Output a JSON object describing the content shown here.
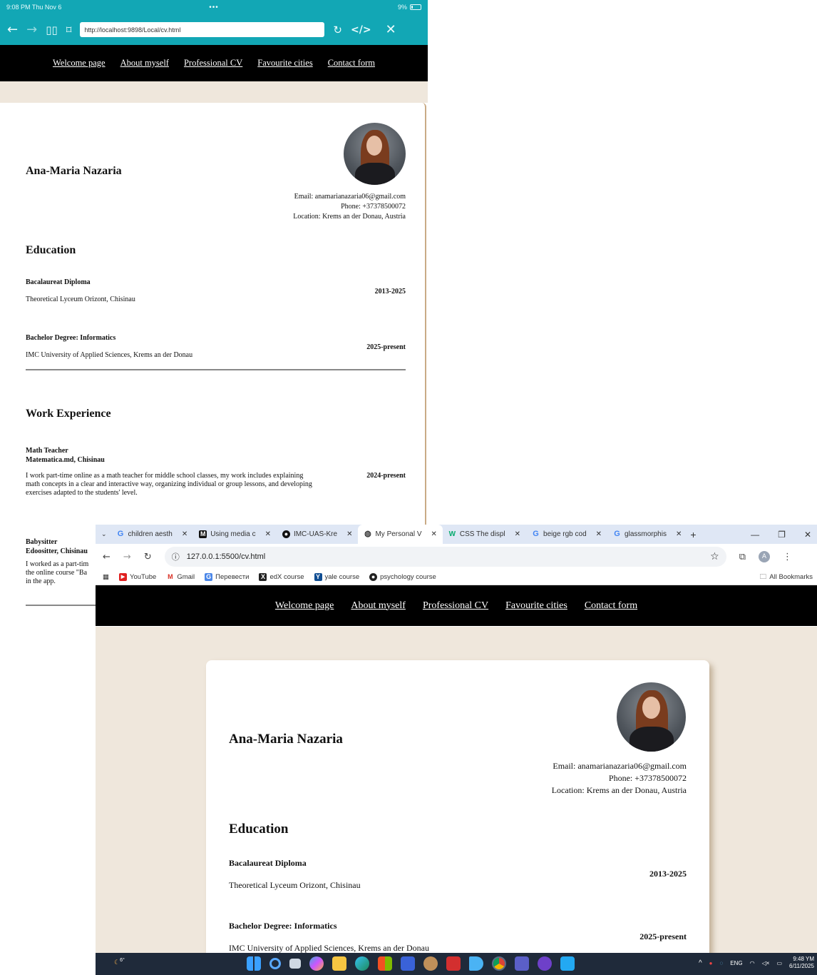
{
  "tablet": {
    "status": {
      "time": "9:08 PM  Thu Nov 6",
      "center_dots": "•••",
      "battery": "9%"
    },
    "url": "http://localhost:9898/Local/cv.html",
    "nav": [
      "Welcome page",
      "About myself",
      "Professional CV",
      "Favourite cities",
      "Contact form"
    ],
    "cv": {
      "name": "Ana-Maria Nazaria",
      "email": "Email: anamarianazaria06@gmail.com",
      "phone": "Phone: +37378500072",
      "location": "Location: Krems an der Donau, Austria",
      "education_heading": "Education",
      "education": [
        {
          "title": "Bacalaureat Diploma",
          "place": "Theoretical Lyceum Orizont, Chisinau",
          "date": "2013-2025"
        },
        {
          "title": "Bachelor Degree: Informatics",
          "place": "IMC University of Applied Sciences, Krems an der Donau",
          "date": "2025-present"
        }
      ],
      "work_heading": "Work Experience",
      "work": [
        {
          "title": "Math Teacher",
          "company": "Matematica.md, Chisinau",
          "date": "2024-present",
          "desc": "I work part-time online as a math teacher for middle school classes, my work includes explaining math concepts in a clear and interactive way, organizing individual or group lessons, and developing exercises adapted to the students' level."
        },
        {
          "title": "Babysitter",
          "company": "Edoositter, Chisinau",
          "desc_line1": "I worked as a part-tim",
          "desc_line2": "the online course \"Ba",
          "desc_line3": "in the app."
        }
      ]
    }
  },
  "browser": {
    "tabs": [
      {
        "label": "children aesth",
        "icon": "google-icon"
      },
      {
        "label": "Using media c",
        "icon": "mdn-icon"
      },
      {
        "label": "IMC-UAS-Kre",
        "icon": "github-icon"
      },
      {
        "label": "My Personal V",
        "icon": "globe-icon",
        "active": true
      },
      {
        "label": "CSS The displ",
        "icon": "w3schools-icon"
      },
      {
        "label": "beige rgb cod",
        "icon": "google-icon"
      },
      {
        "label": "glassmorphis",
        "icon": "google-icon"
      }
    ],
    "new_tab": "+",
    "url": "127.0.0.1:5500/cv.html",
    "bookmarks": [
      "YouTube",
      "Gmail",
      "Перевести",
      "edX course",
      "yale course",
      "psychology course"
    ],
    "all_bookmarks": "All Bookmarks",
    "nav": [
      "Welcome page",
      "About myself",
      "Professional CV",
      "Favourite cities",
      "Contact form"
    ],
    "cv": {
      "name": "Ana-Maria Nazaria",
      "email": "Email: anamarianazaria06@gmail.com",
      "phone": "Phone: +37378500072",
      "location": "Location: Krems an der Donau, Austria",
      "education_heading": "Education",
      "education": [
        {
          "title": "Bacalaureat Diploma",
          "place": "Theoretical Lyceum Orizont, Chisinau",
          "date": "2013-2025"
        },
        {
          "title": "Bachelor Degree: Informatics",
          "place": "IMC University of Applied Sciences, Krems an der Donau",
          "date": "2025-present"
        }
      ]
    },
    "taskbar": {
      "weather": "6°",
      "lang": "ENG",
      "time": "9:48 YM",
      "date": "6/11/2025"
    }
  },
  "colors": {
    "tablet_bar": "#12a7b5",
    "nav_bg": "#000000",
    "beige": "#efe7dc",
    "taskbar": "#1f2a3a"
  }
}
